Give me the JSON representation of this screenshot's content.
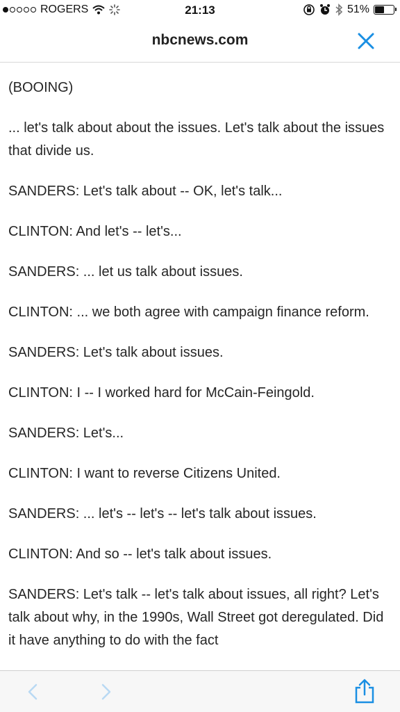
{
  "status_bar": {
    "carrier": "ROGERS",
    "time": "21:13",
    "battery_percent": "51%",
    "battery_level": 0.51,
    "icons": [
      "signal-dots-icon",
      "wifi-icon",
      "activity-spinner-icon",
      "orientation-lock-icon",
      "alarm-icon",
      "bluetooth-icon",
      "battery-icon"
    ]
  },
  "nav": {
    "domain": "nbcnews.com",
    "close_icon": "close-icon",
    "accent_color": "#1a8fe3"
  },
  "transcript": [
    "(BOOING)",
    "... let's talk about about the issues. Let's talk about the issues that divide us.",
    "SANDERS: Let's talk about -- OK, let's talk...",
    "CLINTON: And let's -- let's...",
    "SANDERS: ... let us talk about issues.",
    "CLINTON: ... we both agree with campaign finance reform.",
    "SANDERS: Let's talk about issues.",
    "CLINTON: I -- I worked hard for McCain-Feingold.",
    "SANDERS: Let's...",
    "CLINTON: I want to reverse Citizens United.",
    "SANDERS: ... let's -- let's -- let's talk about issues.",
    "CLINTON: And so -- let's talk about issues.",
    "SANDERS: Let's talk -- let's talk about issues, all right? Let's talk about why, in the 1990s, Wall Street got deregulated. Did it have anything to do with the fact"
  ],
  "toolbar": {
    "back_icon": "chevron-left-icon",
    "forward_icon": "chevron-right-icon",
    "share_icon": "share-icon",
    "disabled_color": "#b9d9f3",
    "accent_color": "#1a8fe3"
  }
}
